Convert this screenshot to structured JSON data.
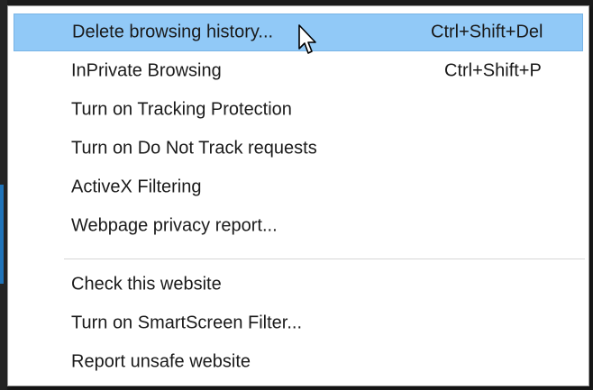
{
  "menu": {
    "items": [
      {
        "label": "Delete browsing history...",
        "shortcut": "Ctrl+Shift+Del"
      },
      {
        "label": "InPrivate Browsing",
        "shortcut": "Ctrl+Shift+P"
      },
      {
        "label": "Turn on Tracking Protection",
        "shortcut": ""
      },
      {
        "label": "Turn on Do Not Track requests",
        "shortcut": ""
      },
      {
        "label": "ActiveX Filtering",
        "shortcut": ""
      },
      {
        "label": "Webpage privacy report...",
        "shortcut": ""
      },
      {
        "label": "Check this website",
        "shortcut": ""
      },
      {
        "label": "Turn on SmartScreen Filter...",
        "shortcut": ""
      },
      {
        "label": "Report unsafe website",
        "shortcut": ""
      }
    ],
    "highlighted_index": 0,
    "colors": {
      "highlight": "#91c9f7",
      "highlight_border": "#78b4e6",
      "text": "#1a1a1a"
    }
  },
  "cursor": {
    "icon": "mouse-pointer-icon"
  }
}
